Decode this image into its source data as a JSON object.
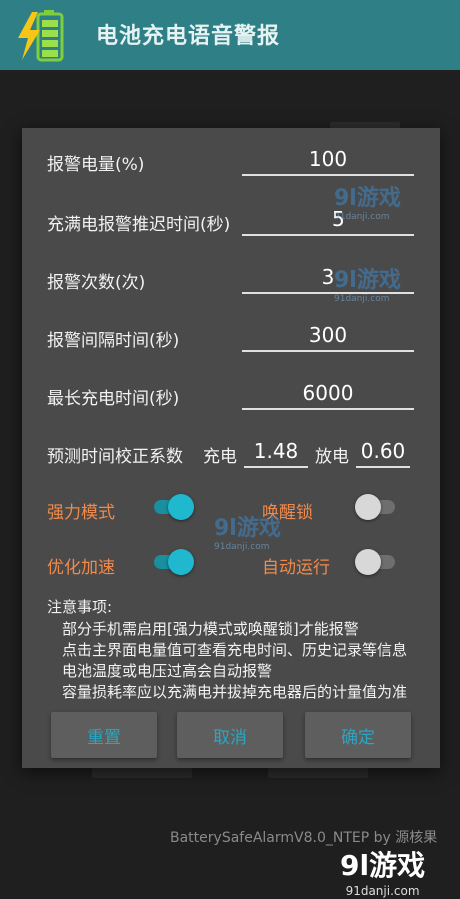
{
  "app": {
    "title": "电池充电语音警报",
    "icon": "battery-charging-icon"
  },
  "dialog": {
    "fields": [
      {
        "label": "报警电量(%)",
        "value": "100"
      },
      {
        "label": "充满电报警推迟时间(秒)",
        "value": "5"
      },
      {
        "label": "报警次数(次)",
        "value": "3"
      },
      {
        "label": "报警间隔时间(秒)",
        "value": "300"
      },
      {
        "label": "最长充电时间(秒)",
        "value": "6000"
      }
    ],
    "correction": {
      "label": "预测时间校正系数",
      "charge_label": "充电",
      "charge_value": "1.48",
      "discharge_label": "放电",
      "discharge_value": "0.60"
    },
    "toggles": {
      "strong_mode": {
        "label": "强力模式",
        "on": true
      },
      "wake_lock": {
        "label": "唤醒锁",
        "on": false
      },
      "optimize": {
        "label": "优化加速",
        "on": true
      },
      "auto_run": {
        "label": "自动运行",
        "on": false
      }
    },
    "notes": {
      "title": "注意事项:",
      "lines": [
        "部分手机需启用[强力模式或唤醒锁]才能报警",
        "点击主界面电量值可查看充电时间、历史记录等信息",
        "电池温度或电压过高会自动报警",
        "容量损耗率应以充满电并拔掉充电器后的计量值为准"
      ]
    },
    "buttons": {
      "reset": "重置",
      "cancel": "取消",
      "ok": "确定"
    }
  },
  "footer": {
    "version_text": "BatterySafeAlarmV8.0_NTEP by 源核果"
  },
  "watermark": {
    "logo": "9l游戏",
    "site": "91danji.com"
  },
  "colors": {
    "appbar": "#2f7f86",
    "dialog": "#4a4a4a",
    "accent": "#1fb8cf",
    "toggle_label": "#f08a4b",
    "button_text": "#2aa6c2"
  }
}
